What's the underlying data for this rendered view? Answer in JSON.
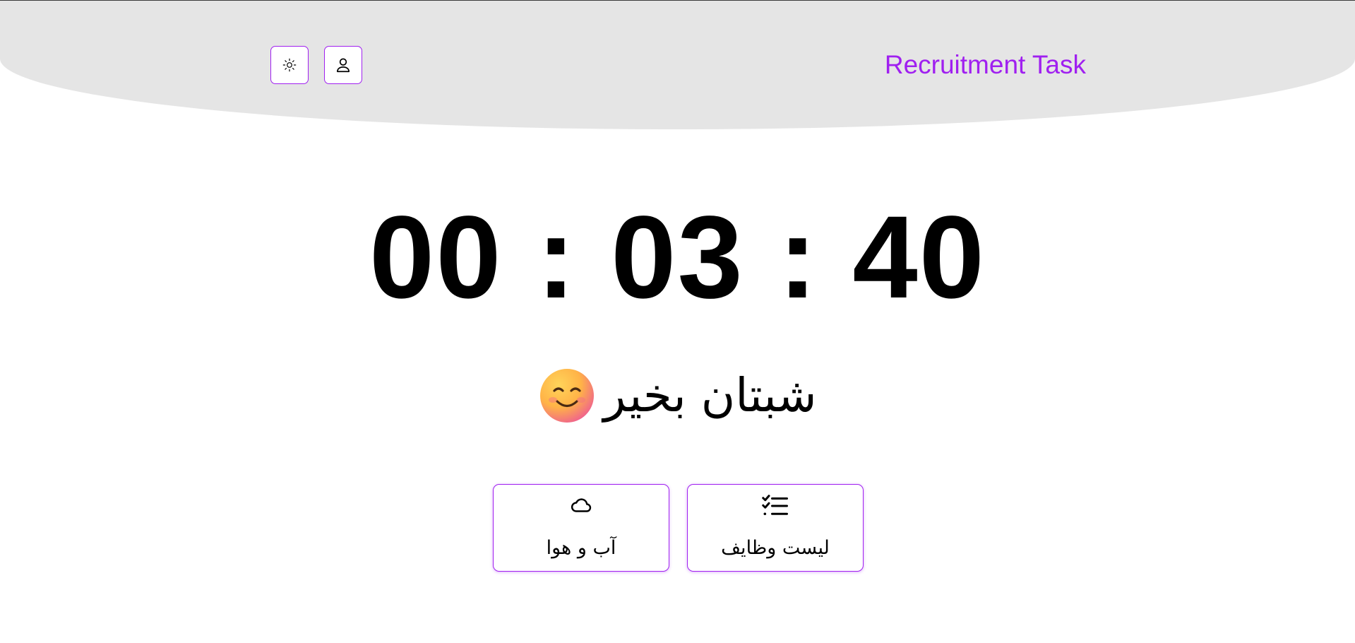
{
  "header": {
    "brand_title": "Recruitment Task",
    "theme_toggle_icon": "sun-icon",
    "profile_icon": "user-icon"
  },
  "clock": {
    "hours": "00",
    "minutes": "03",
    "seconds": "40",
    "separator": ":"
  },
  "greeting": {
    "text": "شبتان بخیر",
    "emoji_icon": "smiling-face-icon"
  },
  "cards": {
    "weather": {
      "label": "آب و هوا",
      "icon": "cloud-icon"
    },
    "tasks": {
      "label": "لیست وظایف",
      "icon": "checklist-icon"
    }
  },
  "colors": {
    "accent": "#a020f0",
    "header_bg": "#e5e5e5",
    "text": "#000000",
    "background": "#ffffff"
  }
}
